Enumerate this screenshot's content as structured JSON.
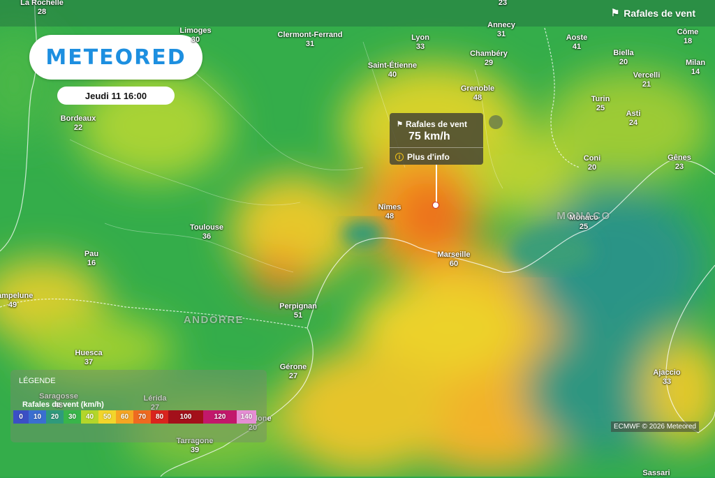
{
  "header": {
    "layer_title": "Rafales de vent"
  },
  "logo": {
    "text": "METEORED"
  },
  "date": {
    "label": "Jeudi 11 16:00"
  },
  "tooltip": {
    "title": "Rafales de vent",
    "value": "75 km/h",
    "more": "Plus d'info"
  },
  "legend": {
    "title": "LÉGENDE",
    "subtitle": "Rafales de vent (km/h)",
    "stops": [
      {
        "label": "0",
        "color": "#3b4fc4"
      },
      {
        "label": "10",
        "color": "#3a6fd0"
      },
      {
        "label": "20",
        "color": "#2f9a7c"
      },
      {
        "label": "30",
        "color": "#39b54a"
      },
      {
        "label": "40",
        "color": "#b3d62a"
      },
      {
        "label": "50",
        "color": "#f2d52b"
      },
      {
        "label": "60",
        "color": "#f5a623"
      },
      {
        "label": "70",
        "color": "#ee6a20"
      },
      {
        "label": "80",
        "color": "#d9241e"
      },
      {
        "label": "100",
        "color": "#a3101a"
      },
      {
        "label": "120",
        "color": "#c2186b"
      },
      {
        "label": "140",
        "color": "#e58ed4"
      }
    ]
  },
  "cities": [
    {
      "name": "La Rochelle",
      "value": "28"
    },
    {
      "name": "Limoges",
      "value": "30"
    },
    {
      "name": "Clermont-Ferrand",
      "value": "31"
    },
    {
      "name": "Lyon",
      "value": "33"
    },
    {
      "name": "Annecy",
      "value": "31"
    },
    {
      "name": "",
      "value": "23"
    },
    {
      "name": "Aoste",
      "value": "41"
    },
    {
      "name": "Côme",
      "value": "18"
    },
    {
      "name": "Chambéry",
      "value": "29"
    },
    {
      "name": "Biella",
      "value": "20"
    },
    {
      "name": "Milan",
      "value": "14"
    },
    {
      "name": "Saint-Étienne",
      "value": "40"
    },
    {
      "name": "Vercelli",
      "value": "21"
    },
    {
      "name": "Grenoble",
      "value": "48"
    },
    {
      "name": "Turin",
      "value": "25"
    },
    {
      "name": "Asti",
      "value": "24"
    },
    {
      "name": "Bordeaux",
      "value": "22"
    },
    {
      "name": "Coni",
      "value": "20"
    },
    {
      "name": "Gênes",
      "value": "23"
    },
    {
      "name": "Nîmes",
      "value": "48"
    },
    {
      "name": "Monaco",
      "value": "25"
    },
    {
      "name": "Toulouse",
      "value": "36"
    },
    {
      "name": "Pau",
      "value": "16"
    },
    {
      "name": "Marseille",
      "value": "60"
    },
    {
      "name": "Pampelune",
      "value": "49"
    },
    {
      "name": "Perpignan",
      "value": "51"
    },
    {
      "name": "Huesca",
      "value": "37"
    },
    {
      "name": "Gérone",
      "value": "27"
    },
    {
      "name": "Ajaccio",
      "value": "33"
    },
    {
      "name": "Saragosse",
      "value": "43"
    },
    {
      "name": "Lérida",
      "value": "27"
    },
    {
      "name": "Barcelone",
      "value": "20"
    },
    {
      "name": "Tarragone",
      "value": "39"
    },
    {
      "name": "Sassari",
      "value": ""
    }
  ],
  "countries": [
    "ANDORRE",
    "MONACO"
  ],
  "credit": "ECMWF © 2026 Meteored"
}
